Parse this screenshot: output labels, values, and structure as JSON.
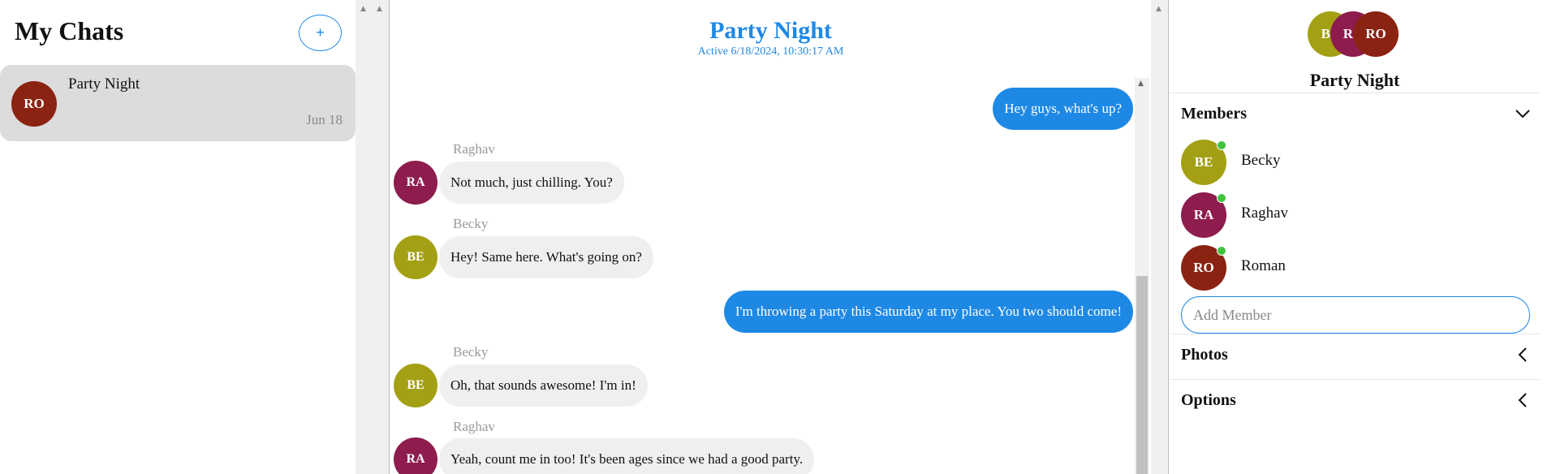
{
  "chat_list": {
    "title": "My Chats",
    "new_chat_label": "+",
    "items": [
      {
        "initials": "RO",
        "avatar_color": "#8b2312",
        "name": "Party Night",
        "date": "Jun 18"
      }
    ]
  },
  "conversation": {
    "title": "Party Night",
    "status": "Active 6/18/2024, 10:30:17 AM",
    "messages": [
      {
        "direction": "out",
        "text": "Hey guys, what's up?"
      },
      {
        "direction": "in",
        "sender": "Raghav",
        "initials": "RA",
        "avatar_color": "#8e1c4e",
        "text": "Not much, just chilling. You?"
      },
      {
        "direction": "in",
        "sender": "Becky",
        "initials": "BE",
        "avatar_color": "#a3a014",
        "text": "Hey! Same here. What's going on?"
      },
      {
        "direction": "out",
        "text": "I'm throwing a party this Saturday at my place. You two should come!"
      },
      {
        "direction": "in",
        "sender": "Becky",
        "initials": "BE",
        "avatar_color": "#a3a014",
        "text": "Oh, that sounds awesome! I'm in!"
      },
      {
        "direction": "in",
        "sender": "Raghav",
        "initials": "RA",
        "avatar_color": "#8e1c4e",
        "text": "Yeah, count me in too! It's been ages since we had a good party."
      }
    ]
  },
  "details": {
    "avatars": [
      {
        "initials": "BE",
        "color": "#a3a014"
      },
      {
        "initials": "RA",
        "color": "#8e1c4e"
      },
      {
        "initials": "RO",
        "color": "#8b2312"
      }
    ],
    "title": "Party Night",
    "members_label": "Members",
    "members": [
      {
        "initials": "BE",
        "color": "#a3a014",
        "name": "Becky",
        "online": true
      },
      {
        "initials": "RA",
        "color": "#8e1c4e",
        "name": "Raghav",
        "online": true
      },
      {
        "initials": "RO",
        "color": "#8b2312",
        "name": "Roman",
        "online": true
      }
    ],
    "add_member_placeholder": "Add Member",
    "photos_label": "Photos",
    "options_label": "Options"
  },
  "colors": {
    "accent": "#1e88e5",
    "online": "#3cc43c",
    "incoming_bubble": "#efefef",
    "selected_chat": "#dcdcdc"
  }
}
